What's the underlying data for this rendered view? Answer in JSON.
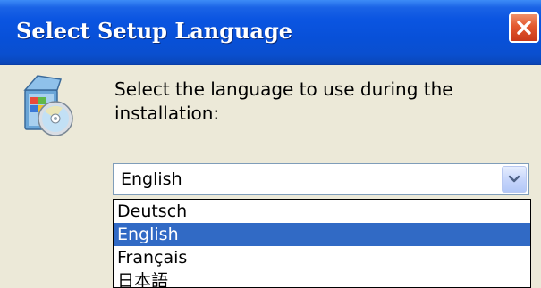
{
  "window": {
    "title": "Select Setup Language",
    "close_icon": "close-icon"
  },
  "dialog": {
    "icon": "setup-cd-icon",
    "instruction": "Select the language to use during the installation:"
  },
  "language_select": {
    "selected": "English",
    "arrow_icon": "chevron-down-icon",
    "options": [
      "Deutsch",
      "English",
      "Français",
      "日本語"
    ],
    "highlighted_index": 1
  },
  "colors": {
    "titlebar": "#0850d8",
    "close_button": "#e3582e",
    "dialog_background": "#ece9d8",
    "selection": "#316ac5"
  }
}
